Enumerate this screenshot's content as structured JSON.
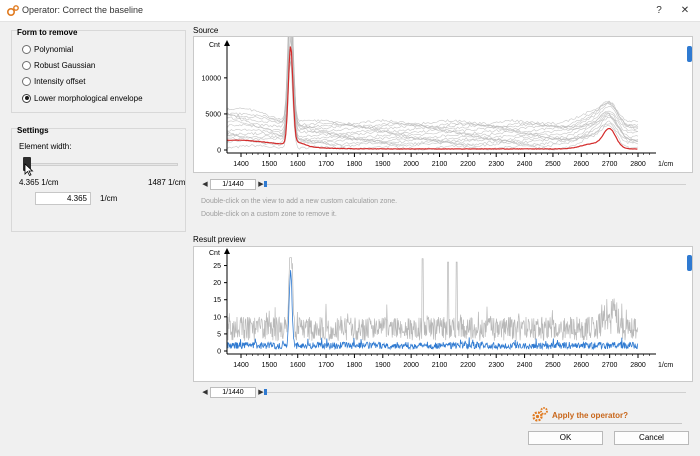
{
  "window": {
    "title": "Operator: Correct the baseline",
    "help_label": "?",
    "close_label": "✕"
  },
  "form_group": {
    "title": "Form to remove",
    "options": [
      {
        "label": "Polynomial",
        "checked": false
      },
      {
        "label": "Robust Gaussian",
        "checked": false
      },
      {
        "label": "Intensity offset",
        "checked": false
      },
      {
        "label": "Lower morphological envelope",
        "checked": true
      }
    ]
  },
  "settings_group": {
    "title": "Settings",
    "element_width_label": "Element width:",
    "min_label": "4.365 1/cm",
    "max_label": "1487 1/cm",
    "value": "4.365",
    "unit": "1/cm"
  },
  "source": {
    "label": "Source",
    "y_label": "Cnt",
    "x_unit": "1/cm",
    "y_ticks": [
      "0",
      "5000",
      "10000"
    ],
    "x_ticks": [
      "1400",
      "1500",
      "1600",
      "1700",
      "1800",
      "1900",
      "2000",
      "2100",
      "2200",
      "2300",
      "2400",
      "2500",
      "2600",
      "2700",
      "2800"
    ],
    "nav_value": "1/1440",
    "hints": [
      "Double-click on the view to add a new custom calculation zone.",
      "Double-click on a custom zone to remove it."
    ],
    "colors": {
      "raw": "#b8b8b8",
      "baseline": "#d42a2a"
    }
  },
  "result": {
    "label": "Result preview",
    "y_label": "Cnt",
    "x_unit": "1/cm",
    "y_ticks": [
      "0",
      "5",
      "10",
      "15",
      "20",
      "25"
    ],
    "x_ticks": [
      "1400",
      "1500",
      "1600",
      "1700",
      "1800",
      "1900",
      "2000",
      "2100",
      "2200",
      "2300",
      "2400",
      "2500",
      "2600",
      "2700",
      "2800"
    ],
    "nav_value": "1/1440",
    "colors": {
      "raw": "#b8b8b8",
      "result": "#2f7ad1"
    }
  },
  "footer": {
    "apply_label": "Apply the operator?",
    "ok_label": "OK",
    "cancel_label": "Cancel",
    "accent": "#c8661a"
  }
}
